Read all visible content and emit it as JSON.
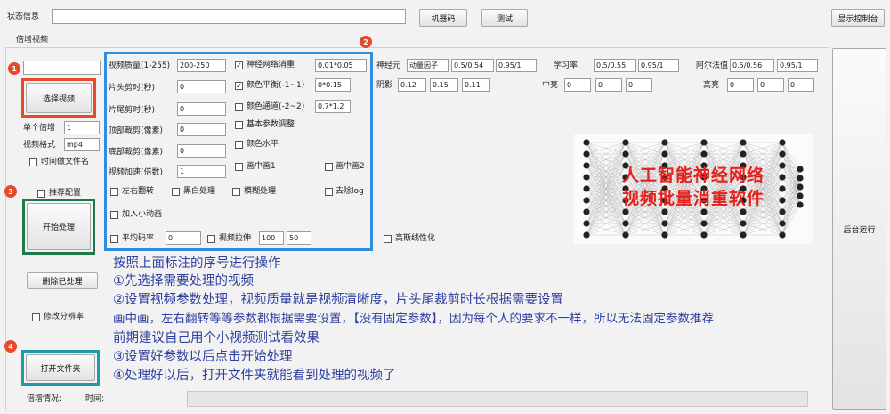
{
  "top_bar": {
    "status_label": "状态信息",
    "status_value": "",
    "machine_code_button": "机器码",
    "test_button": "测试",
    "show_console_button": "显示控制台"
  },
  "section_title": "倍增视频",
  "left_panel": {
    "path_input": "",
    "select_video_button": "选择视频",
    "single_multiple_label": "单个倍增",
    "single_multiple_value": "1",
    "video_format_label": "视频格式",
    "video_format_value": "mp4",
    "timestamp_filename_label": "时间做文件名",
    "recommended_config_label": "推荐配置",
    "start_process_button": "开始处理",
    "delete_processed_button": "删除已处理",
    "modify_resolution_label": "修改分辨率",
    "open_folder_button": "打开文件夹",
    "multiply_status_label": "倍增情况:",
    "time_label": "时间:"
  },
  "markers": [
    "1",
    "2",
    "3",
    "4"
  ],
  "params": {
    "quality_label": "视频质量(1-255)",
    "quality_value": "200-250",
    "head_cut_label": "片头剪时(秒)",
    "head_cut_value": "0",
    "tail_cut_label": "片尾剪时(秒)",
    "tail_cut_value": "0",
    "top_crop_label": "顶部裁剪(像素)",
    "top_crop_value": "0",
    "bottom_crop_label": "底部裁剪(像素)",
    "bottom_crop_value": "0",
    "speed_label": "视频加速(倍数)",
    "speed_value": "1",
    "nn_denoise_label": "神经网络消重",
    "nn_denoise_value": "0.01*0.05",
    "color_balance_label": "颜色平衡(-1~1)",
    "color_balance_value": "0*0.15",
    "color_channel_label": "颜色通道(-2~2)",
    "color_channel_value": "0.7*1.2",
    "basic_params_label": "基本参数调整",
    "color_level_label": "颜色水平",
    "pip1_label": "画中画1",
    "pip2_label": "画中画2",
    "flip_lr_label": "左右翻转",
    "bw_label": "黑白处理",
    "blur_label": "模糊处理",
    "remove_logo_label": "去除log",
    "add_animation_label": "加入小动画",
    "avg_bitrate_label": "平均码率",
    "avg_bitrate_value": "0",
    "video_stretch_label": "视频拉伸",
    "stretch_w": "100",
    "stretch_h": "50",
    "gauss_label": "高斯线性化"
  },
  "neuron": {
    "neuron_label": "神经元",
    "momentum_label": "动量因子",
    "momentum_v1": "0.5/0.54",
    "momentum_v2": "0.95/1",
    "lr_label": "学习率",
    "lr_v1": "0.5/0.55",
    "lr_v2": "0.95/1",
    "alpha_label": "阿尔法值",
    "alpha_v1": "0.5/0.56",
    "alpha_v2": "0.95/1",
    "shadow_label": "阴影",
    "shadow_v1": "0.12",
    "shadow_v2": "0.15",
    "shadow_v3": "0.11",
    "mid_label": "中亮",
    "mid_v1": "0",
    "mid_v2": "0",
    "mid_v3": "0",
    "high_label": "高亮",
    "high_v1": "0",
    "high_v2": "0",
    "high_v3": "0"
  },
  "banner": {
    "line1": "人工智能神经网络",
    "line2": "视频批量消重软件"
  },
  "background_run_button": "后台运行",
  "instructions": [
    "按照上面标注的序号进行操作",
    "①先选择需要处理的视频",
    "②设置视频参数处理，视频质量就是视频清晰度，片头尾裁剪时长根据需要设置",
    "画中画，左右翻转等等参数都根据需要设置，【没有固定参数】，因为每个人的要求不一样，所以无法固定参数推荐",
    "前期建议自己用个小视频测试看效果",
    "③设置好参数以后点击开始处理",
    "④处理好以后，打开文件夹就能看到处理的视频了"
  ],
  "colors": {
    "marker": "#e54b2a",
    "box_red": "#e54b2a",
    "box_blue": "#2f8fdc",
    "box_green": "#1f7a4a",
    "box_cyan": "#1f9aa8",
    "banner_text": "#e6201c",
    "instruction_text": "#2f3fa0"
  }
}
